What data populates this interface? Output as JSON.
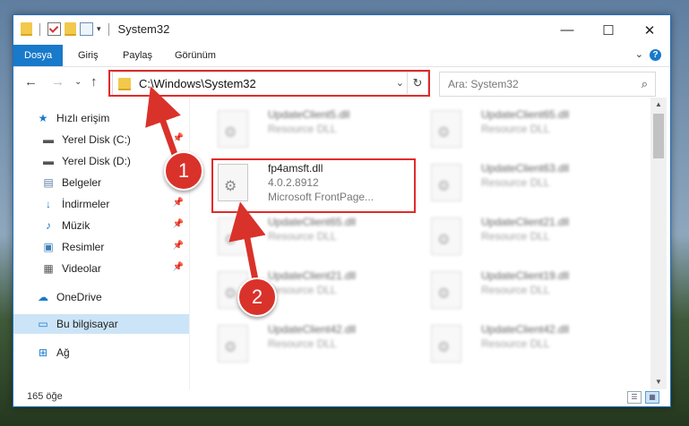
{
  "window": {
    "title": "System32",
    "controls": {
      "minimize": "—",
      "maximize": "☐",
      "close": "✕"
    }
  },
  "ribbon": {
    "tabs": [
      "Dosya",
      "Giriş",
      "Paylaş",
      "Görünüm"
    ],
    "active_tab": "Dosya",
    "help": "?",
    "expand_glyph": "⌄"
  },
  "nav": {
    "back": "←",
    "forward": "→",
    "recent": "⌄",
    "up": "↑",
    "address": "C:\\Windows\\System32",
    "address_dropdown": "⌄",
    "refresh": "↻",
    "search_placeholder": "Ara: System32",
    "search_glyph": "⌕"
  },
  "sidebar": {
    "items": [
      {
        "label": "Hızlı erişim",
        "icon": "star-icon",
        "glyph": "★",
        "color": "#1979ca",
        "pinned": false,
        "selected": false
      },
      {
        "label": "Yerel Disk (C:)",
        "icon": "drive-icon",
        "glyph": "▬",
        "color": "#555555",
        "pinned": true,
        "selected": false
      },
      {
        "label": "Yerel Disk (D:)",
        "icon": "drive-icon",
        "glyph": "▬",
        "color": "#555555",
        "pinned": true,
        "selected": false
      },
      {
        "label": "Belgeler",
        "icon": "document-icon",
        "glyph": "▤",
        "color": "#5b7fa6",
        "pinned": true,
        "selected": false
      },
      {
        "label": "İndirmeler",
        "icon": "download-icon",
        "glyph": "↓",
        "color": "#1979ca",
        "pinned": true,
        "selected": false
      },
      {
        "label": "Müzik",
        "icon": "music-icon",
        "glyph": "♪",
        "color": "#1979ca",
        "pinned": true,
        "selected": false
      },
      {
        "label": "Resimler",
        "icon": "pictures-icon",
        "glyph": "▣",
        "color": "#3b7fb8",
        "pinned": true,
        "selected": false
      },
      {
        "label": "Videolar",
        "icon": "video-icon",
        "glyph": "▦",
        "color": "#555555",
        "pinned": true,
        "selected": false
      },
      {
        "label": "OneDrive",
        "icon": "cloud-icon",
        "glyph": "☁",
        "color": "#1979ca",
        "pinned": false,
        "selected": false
      },
      {
        "label": "Bu bilgisayar",
        "icon": "computer-icon",
        "glyph": "▭",
        "color": "#1979ca",
        "pinned": false,
        "selected": true
      },
      {
        "label": "Ağ",
        "icon": "network-icon",
        "glyph": "⊞",
        "color": "#1979ca",
        "pinned": false,
        "selected": false
      }
    ],
    "pin_glyph": "📌"
  },
  "files": [
    {
      "name": "UpdateClient5.dll",
      "lines": [
        "Resource DLL"
      ],
      "blurred": true
    },
    {
      "name": "UpdateClient65.dll",
      "lines": [
        "Resource DLL"
      ],
      "blurred": true
    },
    {
      "name": "fp4amsft.dll",
      "lines": [
        "4.0.2.8912",
        "Microsoft FrontPage..."
      ],
      "blurred": false
    },
    {
      "name": "UpdateClient63.dll",
      "lines": [
        "Resource DLL"
      ],
      "blurred": true
    },
    {
      "name": "UpdateClient65.dll",
      "lines": [
        "Resource DLL"
      ],
      "blurred": true
    },
    {
      "name": "UpdateClient21.dll",
      "lines": [
        "Resource DLL"
      ],
      "blurred": true
    },
    {
      "name": "UpdateClient21.dll",
      "lines": [
        "Resource DLL"
      ],
      "blurred": true
    },
    {
      "name": "UpdateClient19.dll",
      "lines": [
        "Resource DLL"
      ],
      "blurred": true
    },
    {
      "name": "UpdateClient42.dll",
      "lines": [
        "Resource DLL"
      ],
      "blurred": true
    },
    {
      "name": "UpdateClient42.dll",
      "lines": [
        "Resource DLL"
      ],
      "blurred": true
    }
  ],
  "status": {
    "item_count": "165 öğe"
  },
  "annotations": {
    "step1": "1",
    "step2": "2",
    "highlight_color": "#e02b2b"
  }
}
